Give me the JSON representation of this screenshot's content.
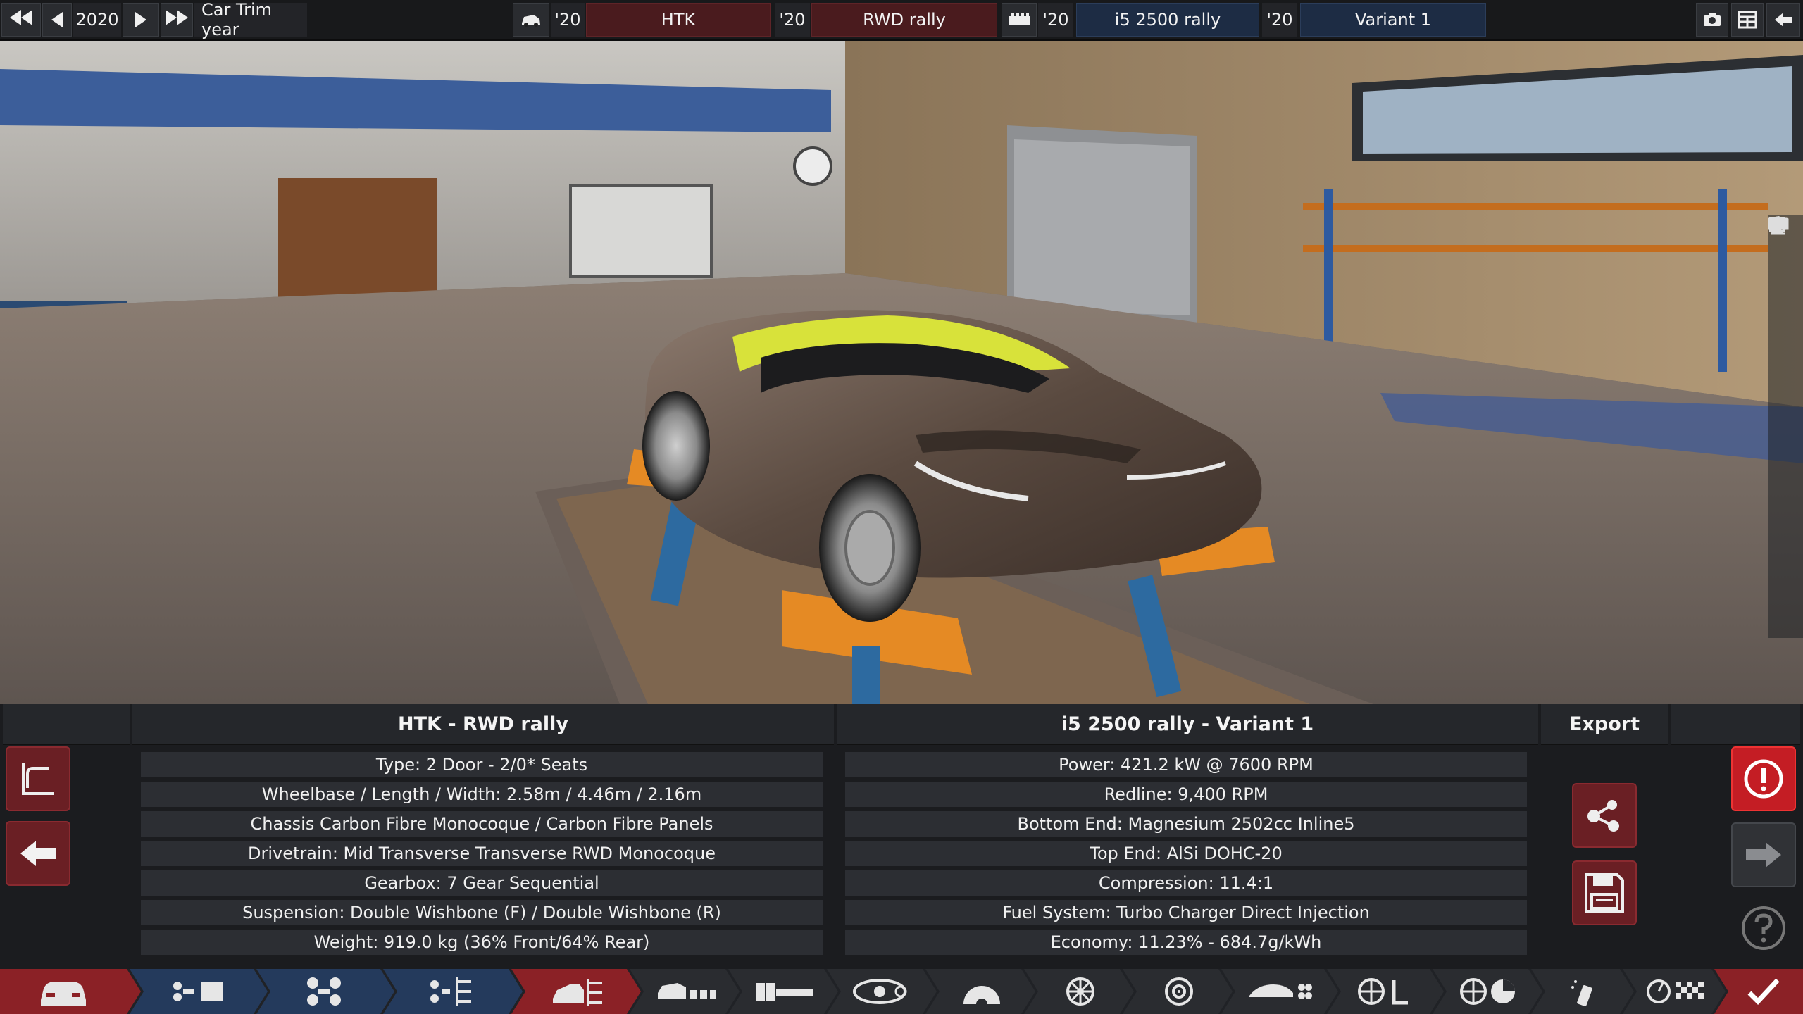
{
  "topbar": {
    "year": "2020",
    "trim_label": "Car Trim year",
    "model_year": "'20",
    "model_name": "HTK",
    "trim_year": "'20",
    "trim_name": "RWD rally",
    "engine_year": "'20",
    "engine_name": "i5 2500 rally",
    "variant_year": "'20",
    "variant_name": "Variant 1"
  },
  "car": {
    "header": "HTK - RWD rally",
    "specs": [
      "Type: 2 Door - 2/0* Seats",
      "Wheelbase / Length / Width: 2.58m / 4.46m / 2.16m",
      "Chassis Carbon Fibre Monocoque / Carbon Fibre Panels",
      "Drivetrain: Mid Transverse Transverse RWD Monocoque",
      "Gearbox: 7 Gear Sequential",
      "Suspension: Double Wishbone (F) / Double Wishbone (R)",
      "Weight: 919.0 kg (36% Front/64% Rear)"
    ]
  },
  "engine": {
    "header": "i5 2500 rally - Variant 1",
    "specs": [
      "Power: 421.2 kW @ 7600 RPM",
      "Redline:  9,400 RPM",
      "Bottom End: Magnesium 2502cc Inline5",
      "Top End: AlSi DOHC-20",
      "Compression: 11.4:1",
      "Fuel System: Turbo Charger Direct Injection",
      "Economy: 11.23% - 684.7g/kWh"
    ]
  },
  "export": {
    "header": "Export"
  },
  "colors": {
    "accent_red": "#c41d24",
    "model_red": "#4a1b1e",
    "engine_blue": "#1d2c44",
    "car_body": "#5a4a40",
    "car_accent": "#d8e23a"
  }
}
